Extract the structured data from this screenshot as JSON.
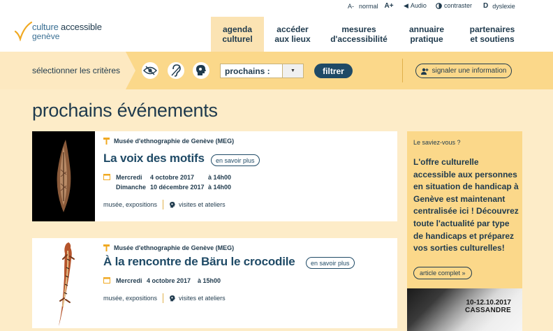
{
  "utility": {
    "font_small": "A-",
    "font_normal": "normal",
    "font_large": "A+",
    "audio": "Audio",
    "contrast": "contraster",
    "dyslexia": "dyslexie"
  },
  "logo": {
    "line1_light": "culture",
    "line1_strong": "accessible",
    "line2": "genève"
  },
  "nav": {
    "items": [
      {
        "line1": "agenda",
        "line2": "culturel",
        "active": true
      },
      {
        "line1": "accéder",
        "line2": "aux lieux",
        "active": false
      },
      {
        "line1": "mesures",
        "line2": "d'accessibilité",
        "active": false
      },
      {
        "line1": "annuaire",
        "line2": "pratique",
        "active": false
      },
      {
        "line1": "partenaires",
        "line2": "et soutiens",
        "active": false
      }
    ]
  },
  "criteria": {
    "label": "sélectionner les critères",
    "select_value": "prochains :",
    "filter_label": "filtrer",
    "signal_label": "signaler une information"
  },
  "page": {
    "title": "prochains événements"
  },
  "events": [
    {
      "venue": "Musée d'ethnographie de Genève (MEG)",
      "title": "La voix des motifs",
      "more_label": "en savoir plus",
      "dates": [
        {
          "day": "Mercredi",
          "date": "4 octobre 2017",
          "time": "à 14h00"
        },
        {
          "day": "Dimanche",
          "date": "10 décembre 2017",
          "time": "à 14h00"
        }
      ],
      "category": "musée, expositions",
      "activity": "visites et ateliers"
    },
    {
      "venue": "Musée d'ethnographie de Genève (MEG)",
      "title": "À la rencontre de Bäru le crocodile",
      "more_label": "en savoir plus",
      "dates": [
        {
          "day": "Mercredi",
          "date": "4 octobre 2017",
          "time": "à 15h00"
        }
      ],
      "category": "musée, expositions",
      "activity": "visites et ateliers"
    }
  ],
  "sidebar": {
    "kicker": "Le saviez-vous ?",
    "text": "L'offre culturelle accessible aux personnes en situation de handicap à Genève est maintenant centralisée ici ! Découvrez toute l'actualité par type de handicaps et préparez vos sorties culturelles!",
    "article_label": "article complet »"
  },
  "promo": {
    "date": "10-12.10.2017",
    "name": "CASSANDRE"
  },
  "colors": {
    "navy": "#1f3a4d",
    "accent_yellow": "#fbd88a",
    "background": "#fdecc8"
  }
}
